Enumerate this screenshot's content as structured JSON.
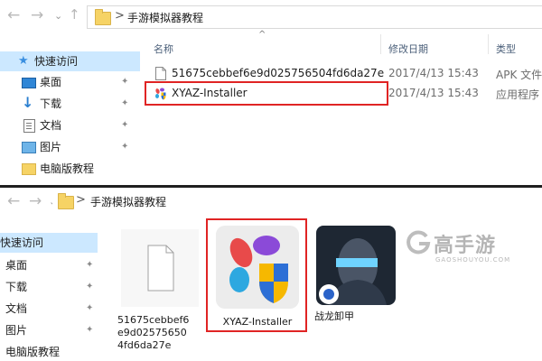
{
  "top_window": {
    "back_icon": "arrow-left-icon",
    "forward_icon": "arrow-right-icon",
    "breadcrumb": {
      "separator": ">",
      "path": "手游模拟器教程"
    },
    "sort_indicator": "^",
    "columns": {
      "name": "名称",
      "date": "修改日期",
      "type": "类型"
    },
    "nav": [
      {
        "label": "快速访问",
        "icon": "star-icon",
        "pinned": false,
        "selected": true
      },
      {
        "label": "桌面",
        "icon": "desktop-icon",
        "pinned": true
      },
      {
        "label": "下载",
        "icon": "download-icon",
        "pinned": true
      },
      {
        "label": "文档",
        "icon": "document-icon",
        "pinned": true
      },
      {
        "label": "图片",
        "icon": "pictures-icon",
        "pinned": true
      },
      {
        "label": "电脑版教程",
        "icon": "folder-icon",
        "pinned": false
      }
    ],
    "files": [
      {
        "name": "51675cebbef6e9d025756504fd6da27e",
        "date": "2017/4/13 15:43",
        "type": "APK 文件",
        "icon": "blank-file-icon"
      },
      {
        "name": "XYAZ-Installer",
        "date": "2017/4/13 15:43",
        "type": "应用程序",
        "icon": "xyaz-installer-icon",
        "highlighted": true
      }
    ]
  },
  "bottom_window": {
    "back_icon": "arrow-left-icon",
    "forward_icon": "arrow-right-icon",
    "breadcrumb": {
      "separator": ">",
      "path": "手游模拟器教程"
    },
    "nav": [
      {
        "label": "快速访问",
        "selected": true
      },
      {
        "label": "桌面",
        "pinned": true
      },
      {
        "label": "下载",
        "pinned": true
      },
      {
        "label": "文档",
        "pinned": true
      },
      {
        "label": "图片",
        "pinned": true
      },
      {
        "label": "电脑版教程",
        "pinned": false
      }
    ],
    "tiles": [
      {
        "label": "51675cebbef6e9d025756504fd6da27e",
        "icon": "blank-file-icon"
      },
      {
        "label": "XYAZ-Installer",
        "icon": "xyaz-installer-icon",
        "highlighted": true
      },
      {
        "label": "战龙卸甲",
        "icon": "game-warrior-icon"
      }
    ],
    "pin_glyph": "✦"
  },
  "watermark": {
    "text": "高手游",
    "subtext": "GAOSHOUYOU.COM"
  },
  "colors": {
    "highlight_red": "#e02424",
    "selection_blue": "#cce8ff",
    "window_divider": "#1f1f1f"
  }
}
